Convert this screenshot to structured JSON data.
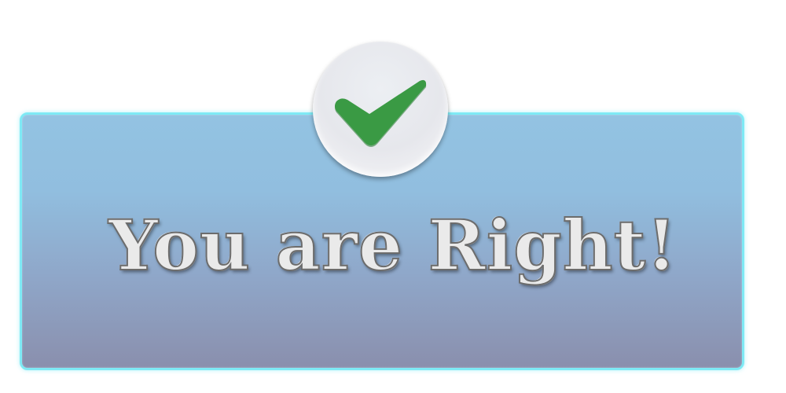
{
  "message": {
    "text": "You are Right!"
  },
  "badge": {
    "icon": "checkmark-icon",
    "icon_color": "#3a9a44"
  },
  "colors": {
    "panel_border": "#7eeaf5",
    "panel_top": "#93c3e2",
    "panel_bottom": "#8a8fad"
  }
}
